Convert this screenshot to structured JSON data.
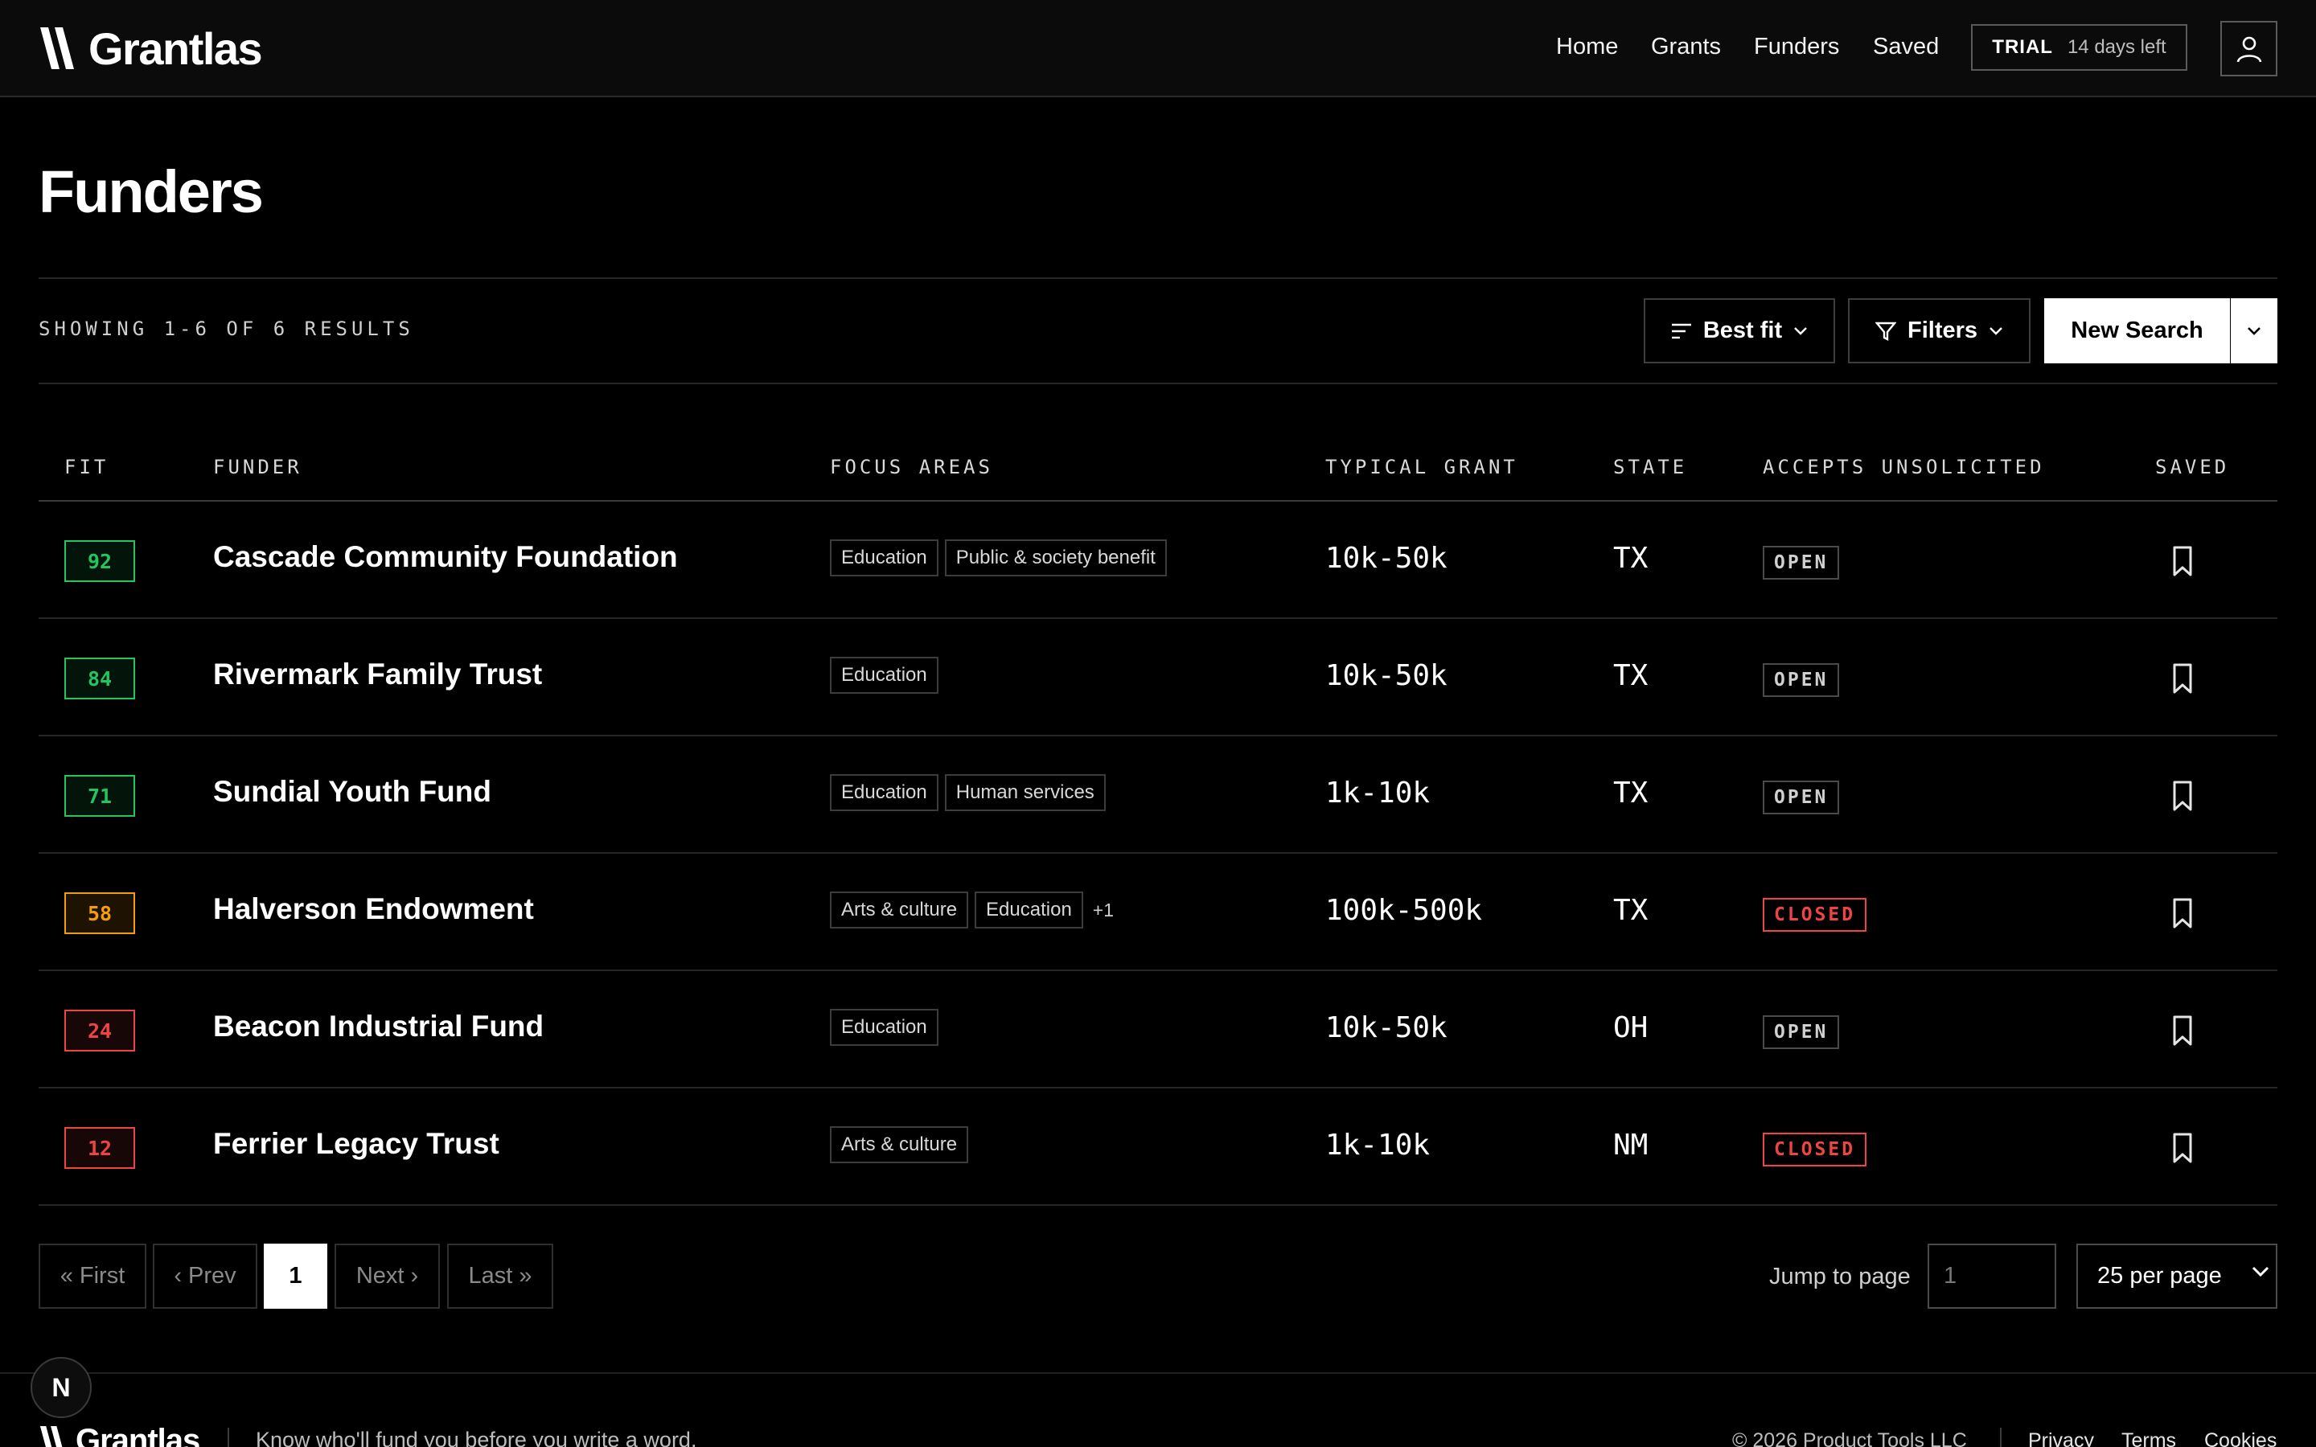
{
  "brand": {
    "name": "Grantlas"
  },
  "nav": {
    "links": [
      "Home",
      "Grants",
      "Funders",
      "Saved"
    ],
    "trial_label": "TRIAL",
    "trial_days": "14 days left",
    "user_icon": "user-icon"
  },
  "page": {
    "title": "Funders"
  },
  "toolbar": {
    "results_text": "SHOWING 1-6 OF 6 RESULTS",
    "sort_label": "Best fit",
    "filters_label": "Filters",
    "new_search_label": "New Search"
  },
  "table": {
    "headers": {
      "fit": "FIT",
      "funder": "FUNDER",
      "focus": "FOCUS AREAS",
      "grant": "TYPICAL GRANT",
      "state": "STATE",
      "unsolicited": "ACCEPTS UNSOLICITED",
      "saved": "SAVED"
    },
    "rows": [
      {
        "fit": "92",
        "fit_level": "high",
        "name": "Cascade Community Foundation",
        "tags": [
          "Education",
          "Public & society benefit"
        ],
        "more": "",
        "grant": "10k-50k",
        "state": "TX",
        "status": "OPEN"
      },
      {
        "fit": "84",
        "fit_level": "high",
        "name": "Rivermark Family Trust",
        "tags": [
          "Education"
        ],
        "more": "",
        "grant": "10k-50k",
        "state": "TX",
        "status": "OPEN"
      },
      {
        "fit": "71",
        "fit_level": "high",
        "name": "Sundial Youth Fund",
        "tags": [
          "Education",
          "Human services"
        ],
        "more": "",
        "grant": "1k-10k",
        "state": "TX",
        "status": "OPEN"
      },
      {
        "fit": "58",
        "fit_level": "mid",
        "name": "Halverson Endowment",
        "tags": [
          "Arts & culture",
          "Education"
        ],
        "more": "+1",
        "grant": "100k-500k",
        "state": "TX",
        "status": "CLOSED"
      },
      {
        "fit": "24",
        "fit_level": "low",
        "name": "Beacon Industrial Fund",
        "tags": [
          "Education"
        ],
        "more": "",
        "grant": "10k-50k",
        "state": "OH",
        "status": "OPEN"
      },
      {
        "fit": "12",
        "fit_level": "low",
        "name": "Ferrier Legacy Trust",
        "tags": [
          "Arts & culture"
        ],
        "more": "",
        "grant": "1k-10k",
        "state": "NM",
        "status": "CLOSED"
      }
    ]
  },
  "colors": {
    "fit_high": "#22c55e",
    "fit_mid": "#f59e0b",
    "fit_low": "#ef4444",
    "closed": "#ef4444"
  },
  "pagination": {
    "first": "« First",
    "prev": "‹ Prev",
    "current": "1",
    "next": "Next ›",
    "last": "Last »",
    "jump_label": "Jump to page",
    "jump_placeholder": "1",
    "per_page": "25 per page"
  },
  "footer": {
    "badge": "N",
    "brand": "Grantlas",
    "tagline": "Know who'll fund you before you write a word.",
    "copyright": "© 2026 Product Tools LLC",
    "links": [
      "Privacy",
      "Terms",
      "Cookies"
    ]
  }
}
